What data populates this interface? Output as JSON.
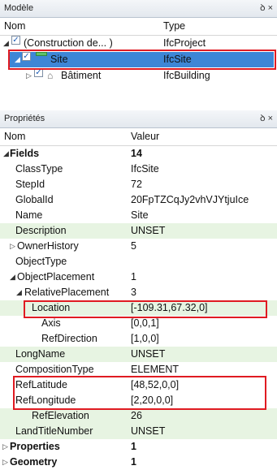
{
  "model_panel": {
    "title": "Modèle",
    "tools": "ꝺ ×",
    "col_name": "Nom",
    "col_type": "Type",
    "rows": [
      {
        "name": "(Construction de... )",
        "type": "IfcProject"
      },
      {
        "name": "Site",
        "type": "IfcSite"
      },
      {
        "name": "Bâtiment",
        "type": "IfcBuilding"
      }
    ]
  },
  "props_panel": {
    "title": "Propriétés",
    "tools": "ꝺ ×",
    "col_name": "Nom",
    "col_value": "Valeur",
    "rows": [
      {
        "name": "Fields",
        "value": "14"
      },
      {
        "name": "ClassType",
        "value": "IfcSite"
      },
      {
        "name": "StepId",
        "value": "72"
      },
      {
        "name": "GlobalId",
        "value": "20FpTZCqJy2vhVJYtjuIce"
      },
      {
        "name": "Name",
        "value": "Site"
      },
      {
        "name": "Description",
        "value": "UNSET"
      },
      {
        "name": "OwnerHistory",
        "value": "5"
      },
      {
        "name": "ObjectType",
        "value": ""
      },
      {
        "name": "ObjectPlacement",
        "value": "1"
      },
      {
        "name": "RelativePlacement",
        "value": "3"
      },
      {
        "name": "Location",
        "value": "[-109.31,67.32,0]"
      },
      {
        "name": "Axis",
        "value": "[0,0,1]"
      },
      {
        "name": "RefDirection",
        "value": "[1,0,0]"
      },
      {
        "name": "LongName",
        "value": "UNSET"
      },
      {
        "name": "CompositionType",
        "value": "ELEMENT"
      },
      {
        "name": "RefLatitude",
        "value": "[48,52,0,0]"
      },
      {
        "name": "RefLongitude",
        "value": "[2,20,0,0]"
      },
      {
        "name": "RefElevation",
        "value": "26"
      },
      {
        "name": "LandTitleNumber",
        "value": "UNSET"
      },
      {
        "name": "Properties",
        "value": "1"
      },
      {
        "name": "Geometry",
        "value": "1"
      }
    ]
  },
  "colors": {
    "highlight": "#e01b22",
    "selection": "#3e86d6",
    "alt_row": "#e7f4e2"
  }
}
